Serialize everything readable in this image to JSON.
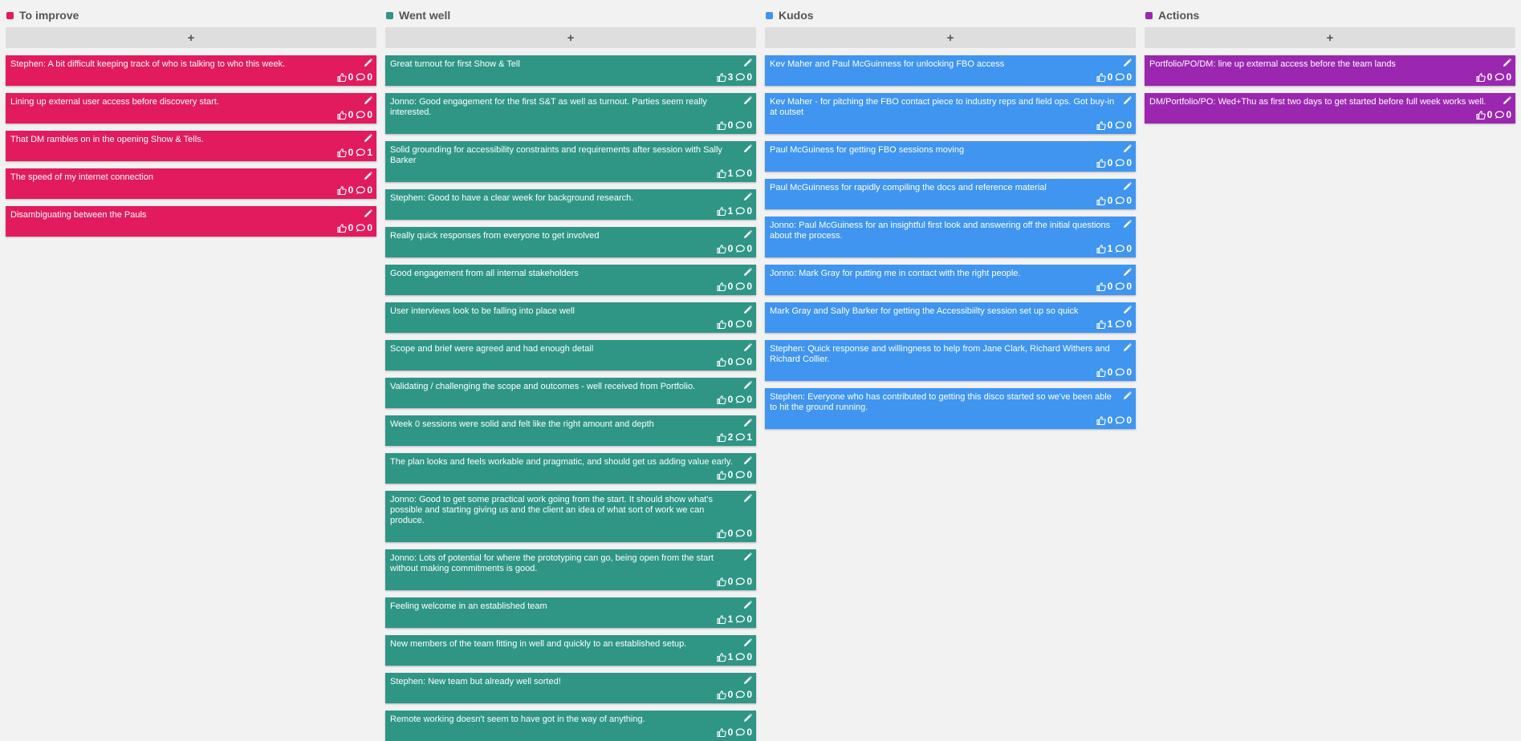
{
  "columns": [
    {
      "title": "To improve",
      "color": "#e21b5e",
      "add_label": "+",
      "cards": [
        {
          "text": "Stephen: A bit difficult keeping track of who is talking to who this week.",
          "likes": "0",
          "comments": "0"
        },
        {
          "text": "Lining up external user access before discovery start.",
          "likes": "0",
          "comments": "0"
        },
        {
          "text": "That DM rambles on in the opening Show & Tells.",
          "likes": "0",
          "comments": "1"
        },
        {
          "text": "The speed of my internet connection",
          "likes": "0",
          "comments": "0"
        },
        {
          "text": "Disambiguating between the Pauls",
          "likes": "0",
          "comments": "0"
        }
      ]
    },
    {
      "title": "Went well",
      "color": "#2f9686",
      "add_label": "+",
      "cards": [
        {
          "text": "Great turnout for first Show & Tell",
          "likes": "3",
          "comments": "0"
        },
        {
          "text": "Jonno: Good engagement for the first S&T as well as turnout. Parties seem really interested.",
          "likes": "0",
          "comments": "0"
        },
        {
          "text": "Solid grounding for accessibility constraints and requirements after session with Sally Barker",
          "likes": "1",
          "comments": "0"
        },
        {
          "text": "Stephen: Good to have a clear week for background research.",
          "likes": "1",
          "comments": "0"
        },
        {
          "text": "Really quick responses from everyone to get involved",
          "likes": "0",
          "comments": "0"
        },
        {
          "text": "Good engagement from all internal stakeholders",
          "likes": "0",
          "comments": "0"
        },
        {
          "text": "User interviews look to be falling into place well",
          "likes": "0",
          "comments": "0"
        },
        {
          "text": "Scope and brief were agreed and had enough detail",
          "likes": "0",
          "comments": "0"
        },
        {
          "text": "Validating / challenging the scope and outcomes - well received from Portfolio.",
          "likes": "0",
          "comments": "0"
        },
        {
          "text": "Week 0 sessions were solid and felt like the right amount and depth",
          "likes": "2",
          "comments": "1"
        },
        {
          "text": "The plan looks and feels workable and pragmatic, and should get us adding value early.",
          "likes": "0",
          "comments": "0"
        },
        {
          "text": "Jonno: Good to get some practical work going from the start. It should show what's possible and starting giving us and the client an idea of what sort of work we can produce.",
          "likes": "0",
          "comments": "0"
        },
        {
          "text": "Jonno: Lots of potential for where the prototyping can go, being open from the start without making commitments is good.",
          "likes": "0",
          "comments": "0"
        },
        {
          "text": "Feeling welcome in an established team",
          "likes": "1",
          "comments": "0"
        },
        {
          "text": "New members of the team fitting in well and quickly to an established setup.",
          "likes": "1",
          "comments": "0"
        },
        {
          "text": "Stephen: New team but already well sorted!",
          "likes": "0",
          "comments": "0"
        },
        {
          "text": "Remote working doesn't seem to have got in the way of anything.",
          "likes": "0",
          "comments": "0"
        }
      ]
    },
    {
      "title": "Kudos",
      "color": "#3f95f0",
      "add_label": "+",
      "cards": [
        {
          "text": "Kev Maher and Paul McGuinness for unlocking FBO access",
          "likes": "0",
          "comments": "0"
        },
        {
          "text": "Kev Maher - for pitching the FBO contact piece to industry reps and field ops. Got buy-in at outset",
          "likes": "0",
          "comments": "0"
        },
        {
          "text": "Paul McGuiness for getting FBO sessions moving",
          "likes": "0",
          "comments": "0"
        },
        {
          "text": "Paul McGuinness for rapidly compiling the docs and reference material",
          "likes": "0",
          "comments": "0"
        },
        {
          "text": "Jonno: Paul McGuiness for an insightful first look and answering off the initial questions about the process.",
          "likes": "1",
          "comments": "0"
        },
        {
          "text": "Jonno: Mark Gray for putting me in contact with the right people.",
          "likes": "0",
          "comments": "0"
        },
        {
          "text": "Mark Gray and Sally Barker for getting the Accessibiilty session set up so quick",
          "likes": "1",
          "comments": "0"
        },
        {
          "text": "Stephen: Quick response and willingness to help from Jane Clark, Richard Withers and Richard Collier.",
          "likes": "0",
          "comments": "0"
        },
        {
          "text": "Stephen: Everyone who has contributed to getting this disco started so we've been able to hit the ground running.",
          "likes": "0",
          "comments": "0"
        }
      ]
    },
    {
      "title": "Actions",
      "color": "#9b27b0",
      "add_label": "+",
      "cards": [
        {
          "text": "Portfolio/PO/DM: line up external access before the team lands",
          "likes": "0",
          "comments": "0"
        },
        {
          "text": "DM/Portfolio/PO: Wed+Thu as first two days to get started before full week works well.",
          "likes": "0",
          "comments": "0"
        }
      ]
    }
  ]
}
